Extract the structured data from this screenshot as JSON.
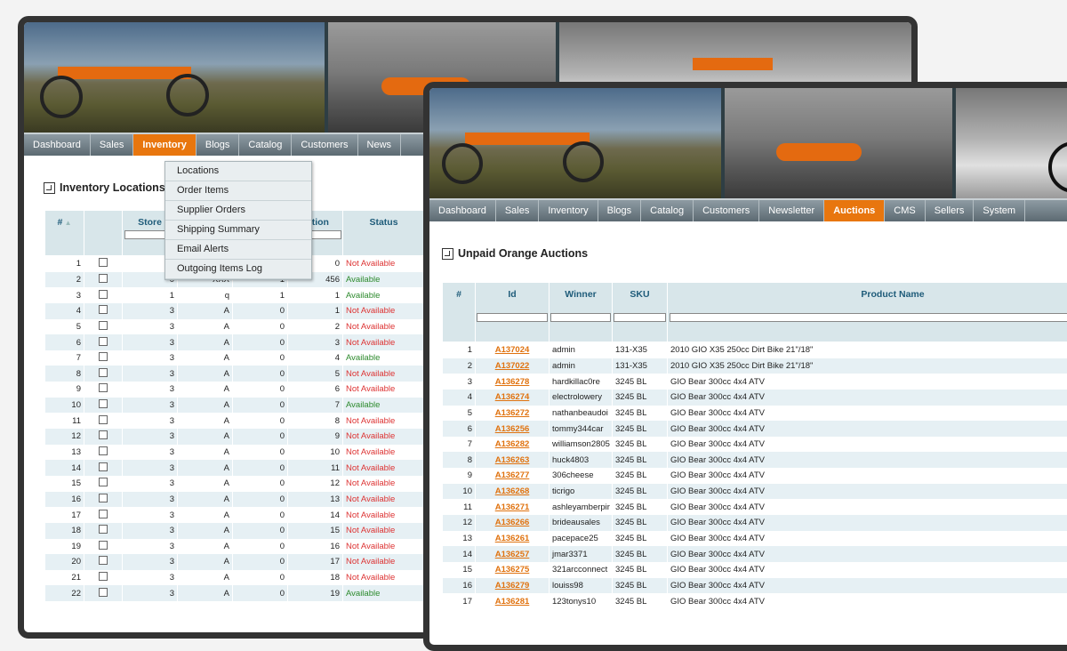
{
  "back_window": {
    "nav": [
      "Dashboard",
      "Sales",
      "Inventory",
      "Blogs",
      "Catalog",
      "Customers",
      "News"
    ],
    "active_nav": "Inventory",
    "dropdown": [
      "Locations",
      "Order Items",
      "Supplier Orders",
      "Shipping Summary",
      "Email Alerts",
      "Outgoing Items Log"
    ],
    "page_title": "Inventory Locations",
    "columns": [
      "#",
      "",
      "Store",
      "",
      "",
      "ection",
      "Status"
    ],
    "rows": [
      {
        "n": "1",
        "store": "",
        "c3": "",
        "c4": "",
        "c5": "0",
        "status": "Not Available"
      },
      {
        "n": "2",
        "store": "0",
        "c3": "XXX",
        "c4": "1",
        "c5": "456",
        "status": "Available"
      },
      {
        "n": "3",
        "store": "1",
        "c3": "q",
        "c4": "1",
        "c5": "1",
        "status": "Available"
      },
      {
        "n": "4",
        "store": "3",
        "c3": "A",
        "c4": "0",
        "c5": "1",
        "status": "Not Available"
      },
      {
        "n": "5",
        "store": "3",
        "c3": "A",
        "c4": "0",
        "c5": "2",
        "status": "Not Available"
      },
      {
        "n": "6",
        "store": "3",
        "c3": "A",
        "c4": "0",
        "c5": "3",
        "status": "Not Available"
      },
      {
        "n": "7",
        "store": "3",
        "c3": "A",
        "c4": "0",
        "c5": "4",
        "status": "Available"
      },
      {
        "n": "8",
        "store": "3",
        "c3": "A",
        "c4": "0",
        "c5": "5",
        "status": "Not Available"
      },
      {
        "n": "9",
        "store": "3",
        "c3": "A",
        "c4": "0",
        "c5": "6",
        "status": "Not Available"
      },
      {
        "n": "10",
        "store": "3",
        "c3": "A",
        "c4": "0",
        "c5": "7",
        "status": "Available"
      },
      {
        "n": "11",
        "store": "3",
        "c3": "A",
        "c4": "0",
        "c5": "8",
        "status": "Not Available"
      },
      {
        "n": "12",
        "store": "3",
        "c3": "A",
        "c4": "0",
        "c5": "9",
        "status": "Not Available"
      },
      {
        "n": "13",
        "store": "3",
        "c3": "A",
        "c4": "0",
        "c5": "10",
        "status": "Not Available"
      },
      {
        "n": "14",
        "store": "3",
        "c3": "A",
        "c4": "0",
        "c5": "11",
        "status": "Not Available"
      },
      {
        "n": "15",
        "store": "3",
        "c3": "A",
        "c4": "0",
        "c5": "12",
        "status": "Not Available"
      },
      {
        "n": "16",
        "store": "3",
        "c3": "A",
        "c4": "0",
        "c5": "13",
        "status": "Not Available"
      },
      {
        "n": "17",
        "store": "3",
        "c3": "A",
        "c4": "0",
        "c5": "14",
        "status": "Not Available"
      },
      {
        "n": "18",
        "store": "3",
        "c3": "A",
        "c4": "0",
        "c5": "15",
        "status": "Not Available"
      },
      {
        "n": "19",
        "store": "3",
        "c3": "A",
        "c4": "0",
        "c5": "16",
        "status": "Not Available"
      },
      {
        "n": "20",
        "store": "3",
        "c3": "A",
        "c4": "0",
        "c5": "17",
        "status": "Not Available"
      },
      {
        "n": "21",
        "store": "3",
        "c3": "A",
        "c4": "0",
        "c5": "18",
        "status": "Not Available"
      },
      {
        "n": "22",
        "store": "3",
        "c3": "A",
        "c4": "0",
        "c5": "19",
        "status": "Available"
      }
    ]
  },
  "front_window": {
    "nav": [
      "Dashboard",
      "Sales",
      "Inventory",
      "Blogs",
      "Catalog",
      "Customers",
      "Newsletter",
      "Auctions",
      "CMS",
      "Sellers",
      "System"
    ],
    "active_nav": "Auctions",
    "page_title": "Unpaid Orange Auctions",
    "columns": [
      "#",
      "Id",
      "Winner",
      "SKU",
      "Product Name"
    ],
    "rows": [
      {
        "n": "1",
        "id": "A137024",
        "winner": "admin",
        "sku": "131-X35",
        "product": "2010 GIO X35 250cc Dirt Bike 21\"/18\""
      },
      {
        "n": "2",
        "id": "A137022",
        "winner": "admin",
        "sku": "131-X35",
        "product": "2010 GIO X35 250cc Dirt Bike 21\"/18\""
      },
      {
        "n": "3",
        "id": "A136278",
        "winner": "hardkillac0re",
        "sku": "3245 BL",
        "product": "GIO Bear 300cc 4x4 ATV"
      },
      {
        "n": "4",
        "id": "A136274",
        "winner": "electrolowery",
        "sku": "3245 BL",
        "product": "GIO Bear 300cc 4x4 ATV"
      },
      {
        "n": "5",
        "id": "A136272",
        "winner": "nathanbeaudoi",
        "sku": "3245 BL",
        "product": "GIO Bear 300cc 4x4 ATV"
      },
      {
        "n": "6",
        "id": "A136256",
        "winner": "tommy344car",
        "sku": "3245 BL",
        "product": "GIO Bear 300cc 4x4 ATV"
      },
      {
        "n": "7",
        "id": "A136282",
        "winner": "williamson2805",
        "sku": "3245 BL",
        "product": "GIO Bear 300cc 4x4 ATV"
      },
      {
        "n": "8",
        "id": "A136263",
        "winner": "huck4803",
        "sku": "3245 BL",
        "product": "GIO Bear 300cc 4x4 ATV"
      },
      {
        "n": "9",
        "id": "A136277",
        "winner": "306cheese",
        "sku": "3245 BL",
        "product": "GIO Bear 300cc 4x4 ATV"
      },
      {
        "n": "10",
        "id": "A136268",
        "winner": "ticrigo",
        "sku": "3245 BL",
        "product": "GIO Bear 300cc 4x4 ATV"
      },
      {
        "n": "11",
        "id": "A136271",
        "winner": "ashleyamberpir",
        "sku": "3245 BL",
        "product": "GIO Bear 300cc 4x4 ATV"
      },
      {
        "n": "12",
        "id": "A136266",
        "winner": "brideausales",
        "sku": "3245 BL",
        "product": "GIO Bear 300cc 4x4 ATV"
      },
      {
        "n": "13",
        "id": "A136261",
        "winner": "pacepace25",
        "sku": "3245 BL",
        "product": "GIO Bear 300cc 4x4 ATV"
      },
      {
        "n": "14",
        "id": "A136257",
        "winner": "jmar3371",
        "sku": "3245 BL",
        "product": "GIO Bear 300cc 4x4 ATV"
      },
      {
        "n": "15",
        "id": "A136275",
        "winner": "321arcconnect",
        "sku": "3245 BL",
        "product": "GIO Bear 300cc 4x4 ATV"
      },
      {
        "n": "16",
        "id": "A136279",
        "winner": "louiss98",
        "sku": "3245 BL",
        "product": "GIO Bear 300cc 4x4 ATV"
      },
      {
        "n": "17",
        "id": "A136281",
        "winner": "123tonys10",
        "sku": "3245 BL",
        "product": "GIO Bear 300cc 4x4 ATV"
      }
    ]
  },
  "colors": {
    "accent": "#e8760e",
    "available": "#2d8a2d",
    "not_available": "#dd3333",
    "header_bg": "#d8e6ea",
    "alt_row": "#e6f0f4"
  }
}
